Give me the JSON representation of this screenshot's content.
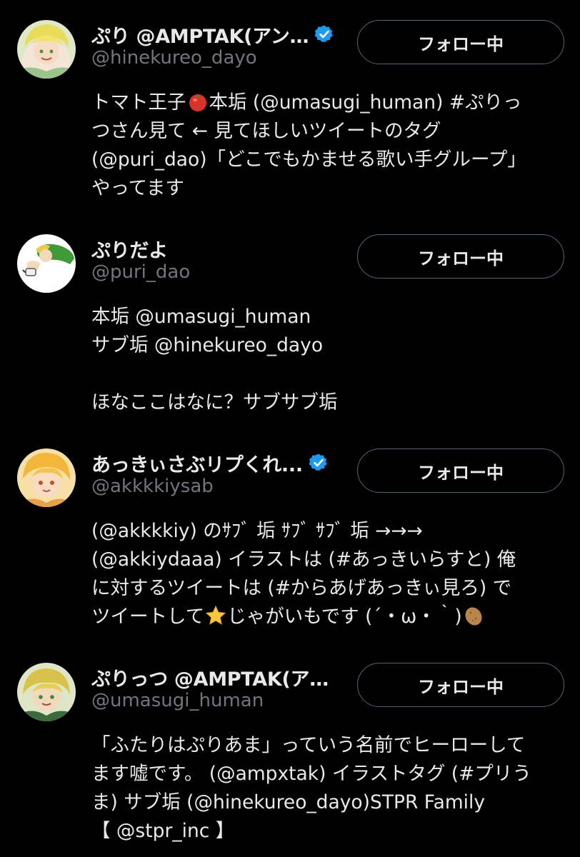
{
  "users": [
    {
      "display_name": "ぷり @AMPTAK(アン…",
      "verified": true,
      "handle": "@hinekureo_dayo",
      "follow_label": "フォロー中",
      "bio": {
        "l1a": "トマト王子",
        "l1_emoji": "tomato",
        "l1b": "本垢 (@umasugi_human) #ぷりっ",
        "l2": "つさん見て ← 見てほしいツイートのタグ",
        "l3": "(@puri_dao)「どこでもかませる歌い手グループ」",
        "l4": "やってます"
      }
    },
    {
      "display_name": "ぷりだよ",
      "verified": false,
      "handle": "@puri_dao",
      "follow_label": "フォロー中",
      "bio": {
        "l1": "本垢 @umasugi_human",
        "l2": "サブ垢 @hinekureo_dayo",
        "l3": "ほなここはなに？サブサブ垢"
      }
    },
    {
      "display_name": "あっきぃさぶリプくれ...",
      "verified": true,
      "handle": "@akkkkiysab",
      "follow_label": "フォロー中",
      "bio": {
        "l1": "(@akkkkiy) のｻﾌﾞ 垢 ｻﾌﾞ ｻﾌﾞ 垢 →→→",
        "l2": "(@akkiydaaa) イラストは (#あっきいらすと) 俺",
        "l3": "に対するツイートは (#からあげあっきぃ見ろ) で",
        "l4a": "ツイートして",
        "l4_emoji1": "star",
        "l4b": "じゃがいもです (´・ω・｀)",
        "l4_emoji2": "potato"
      }
    },
    {
      "display_name": "ぷりっつ @AMPTAK(ア…",
      "verified": false,
      "handle": "@umasugi_human",
      "follow_label": "フォロー中",
      "bio": {
        "l1": "「ふたりはぷりあま」っていう名前でヒーローして",
        "l2": "ます嘘です。 (@ampxtak) イラストタグ (#プリう",
        "l3": "ま) サブ垢 (@hinekureo_dayo)STPR Family",
        "l4": "【 @stpr_inc 】"
      }
    }
  ],
  "colors": {
    "background": "#000000",
    "text": "#e7e9ea",
    "secondary_text": "#71767b",
    "button_border": "#536471",
    "verified": "#1d9bf0"
  }
}
